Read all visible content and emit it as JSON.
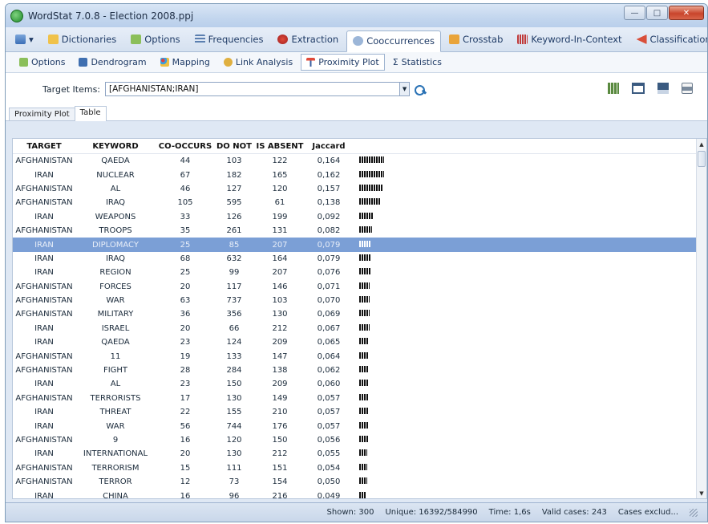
{
  "window": {
    "title": "WordStat 7.0.8 - Election 2008.ppj"
  },
  "main_tabs": [
    {
      "label": "Dictionaries",
      "icon": "book-icon"
    },
    {
      "label": "Options",
      "icon": "options-icon"
    },
    {
      "label": "Frequencies",
      "icon": "frequencies-icon"
    },
    {
      "label": "Extraction",
      "icon": "extraction-icon"
    },
    {
      "label": "Cooccurrences",
      "icon": "cooccurrences-icon",
      "active": true
    },
    {
      "label": "Crosstab",
      "icon": "crosstab-icon"
    },
    {
      "label": "Keyword-In-Context",
      "icon": "kwic-icon"
    },
    {
      "label": "Classification",
      "icon": "classification-icon"
    }
  ],
  "sub_tabs": [
    {
      "label": "Options"
    },
    {
      "label": "Dendrogram"
    },
    {
      "label": "Mapping"
    },
    {
      "label": "Link Analysis"
    },
    {
      "label": "Proximity Plot",
      "active": true
    },
    {
      "label": "Statistics"
    }
  ],
  "toolbar": {
    "target_label": "Target Items:",
    "target_value": "[AFGHANISTAN;IRAN]"
  },
  "view_tabs": [
    {
      "label": "Proximity Plot"
    },
    {
      "label": "Table",
      "active": true
    }
  ],
  "table": {
    "columns": [
      "TARGET",
      "KEYWORD",
      "CO-OCCURS",
      "DO NOT",
      "IS ABSENT",
      "Jaccard"
    ],
    "rows": [
      [
        "AFGHANISTAN",
        "QAEDA",
        "44",
        "103",
        "122",
        "0,164"
      ],
      [
        "IRAN",
        "NUCLEAR",
        "67",
        "182",
        "165",
        "0,162"
      ],
      [
        "AFGHANISTAN",
        "AL",
        "46",
        "127",
        "120",
        "0,157"
      ],
      [
        "AFGHANISTAN",
        "IRAQ",
        "105",
        "595",
        "61",
        "0,138"
      ],
      [
        "IRAN",
        "WEAPONS",
        "33",
        "126",
        "199",
        "0,092"
      ],
      [
        "AFGHANISTAN",
        "TROOPS",
        "35",
        "261",
        "131",
        "0,082"
      ],
      [
        "IRAN",
        "DIPLOMACY",
        "25",
        "85",
        "207",
        "0,079"
      ],
      [
        "IRAN",
        "IRAQ",
        "68",
        "632",
        "164",
        "0,079"
      ],
      [
        "IRAN",
        "REGION",
        "25",
        "99",
        "207",
        "0,076"
      ],
      [
        "AFGHANISTAN",
        "FORCES",
        "20",
        "117",
        "146",
        "0,071"
      ],
      [
        "AFGHANISTAN",
        "WAR",
        "63",
        "737",
        "103",
        "0,070"
      ],
      [
        "AFGHANISTAN",
        "MILITARY",
        "36",
        "356",
        "130",
        "0,069"
      ],
      [
        "IRAN",
        "ISRAEL",
        "20",
        "66",
        "212",
        "0,067"
      ],
      [
        "IRAN",
        "QAEDA",
        "23",
        "124",
        "209",
        "0,065"
      ],
      [
        "AFGHANISTAN",
        "11",
        "19",
        "133",
        "147",
        "0,064"
      ],
      [
        "AFGHANISTAN",
        "FIGHT",
        "28",
        "284",
        "138",
        "0,062"
      ],
      [
        "IRAN",
        "AL",
        "23",
        "150",
        "209",
        "0,060"
      ],
      [
        "AFGHANISTAN",
        "TERRORISTS",
        "17",
        "130",
        "149",
        "0,057"
      ],
      [
        "IRAN",
        "THREAT",
        "22",
        "155",
        "210",
        "0,057"
      ],
      [
        "IRAN",
        "WAR",
        "56",
        "744",
        "176",
        "0,057"
      ],
      [
        "AFGHANISTAN",
        "9",
        "16",
        "120",
        "150",
        "0,056"
      ],
      [
        "IRAN",
        "INTERNATIONAL",
        "20",
        "130",
        "212",
        "0,055"
      ],
      [
        "AFGHANISTAN",
        "TERRORISM",
        "15",
        "111",
        "151",
        "0,054"
      ],
      [
        "AFGHANISTAN",
        "TERROR",
        "12",
        "73",
        "154",
        "0,050"
      ],
      [
        "IRAN",
        "CHINA",
        "16",
        "96",
        "216",
        "0,049"
      ]
    ],
    "selected_row": 6
  },
  "status": {
    "shown": "Shown: 300",
    "unique": "Unique: 16392/584990",
    "time": "Time: 1,6s",
    "valid": "Valid cases: 243",
    "excluded": "Cases exclud..."
  },
  "colors": {
    "selection": "#7b9fd6",
    "title_bar": "#c3d6ee",
    "close_button": "#c9452c"
  }
}
